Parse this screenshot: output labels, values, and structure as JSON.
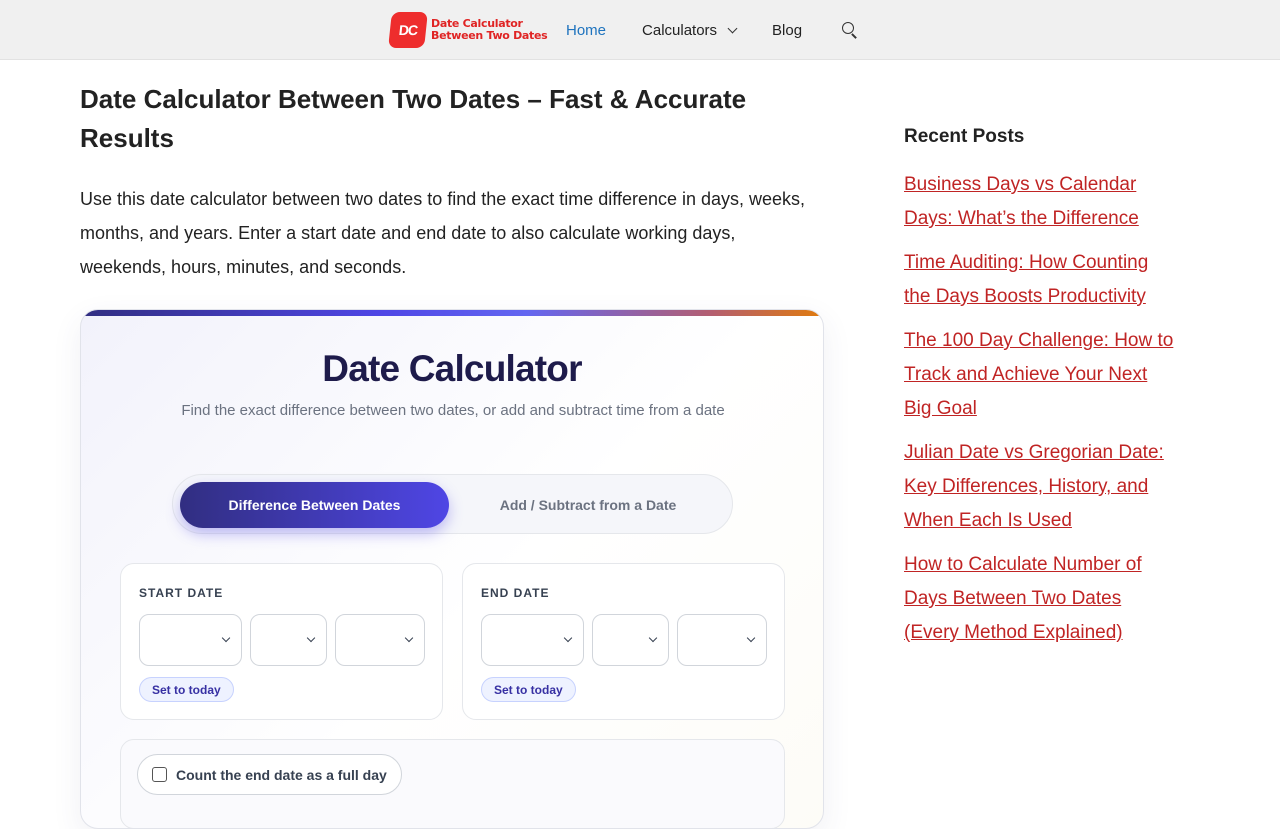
{
  "header": {
    "logo": {
      "mark": "DC",
      "line1": "Date Calculator",
      "line2": "Between Two Dates"
    },
    "nav": [
      {
        "label": "Home",
        "active": true
      },
      {
        "label": "Calculators"
      },
      {
        "label": "Blog"
      }
    ],
    "icons": {
      "search": "search-icon",
      "dropdown": "chevron-down-icon"
    }
  },
  "main": {
    "title": "Date Calculator Between Two Dates – Fast & Accurate Results",
    "intro": "Use this date calculator between two dates to find the exact time difference in days, weeks, months, and years. Enter a start date and end date to also calculate working days, weekends, hours, minutes, and seconds."
  },
  "calculator": {
    "title": "Date Calculator",
    "subtitle": "Find the exact difference between two dates, or add and subtract time from a date",
    "tabs": [
      {
        "label": "Difference Between Dates",
        "active": true
      },
      {
        "label": "Add / Subtract from a Date",
        "active": false
      }
    ],
    "start": {
      "label": "START DATE",
      "today_label": "Set to today"
    },
    "end": {
      "label": "END DATE",
      "today_label": "Set to today"
    },
    "option_checkbox": {
      "label": "Count the end date as a full day",
      "checked": false
    },
    "colors": {
      "accent_dark": "#312e81",
      "accent": "#4f46e5",
      "accent_warm": "#e07b0d"
    }
  },
  "sidebar": {
    "title": "Recent Posts",
    "posts": [
      "Business Days vs Calendar Days: What’s the Difference",
      "Time Auditing: How Counting the Days Boosts Productivity",
      "The 100 Day Challenge: How to Track and Achieve Your Next Big Goal",
      "Julian Date vs Gregorian Date: Key Differences, History, and When Each Is Used",
      "How to Calculate Number of Days Between Two Dates (Every Method Explained)"
    ],
    "link_color": "#c02424"
  }
}
